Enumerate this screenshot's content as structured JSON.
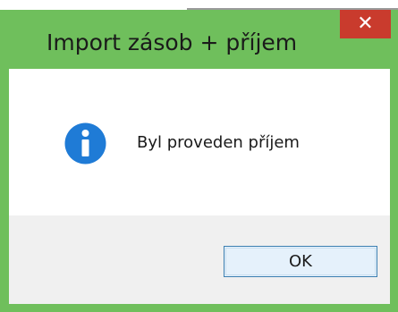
{
  "window": {
    "title": "Import zásob + příjem",
    "close_symbol": "✕"
  },
  "message": {
    "icon": "info-icon",
    "text": "Byl proveden příjem"
  },
  "buttons": {
    "ok_label": "OK"
  },
  "colors": {
    "frame": "#6fbf5c",
    "close_button": "#c93b2d",
    "info_icon": "#1f7bd6",
    "button_bar": "#f0f0f0",
    "ok_border": "#3c7fb1"
  }
}
